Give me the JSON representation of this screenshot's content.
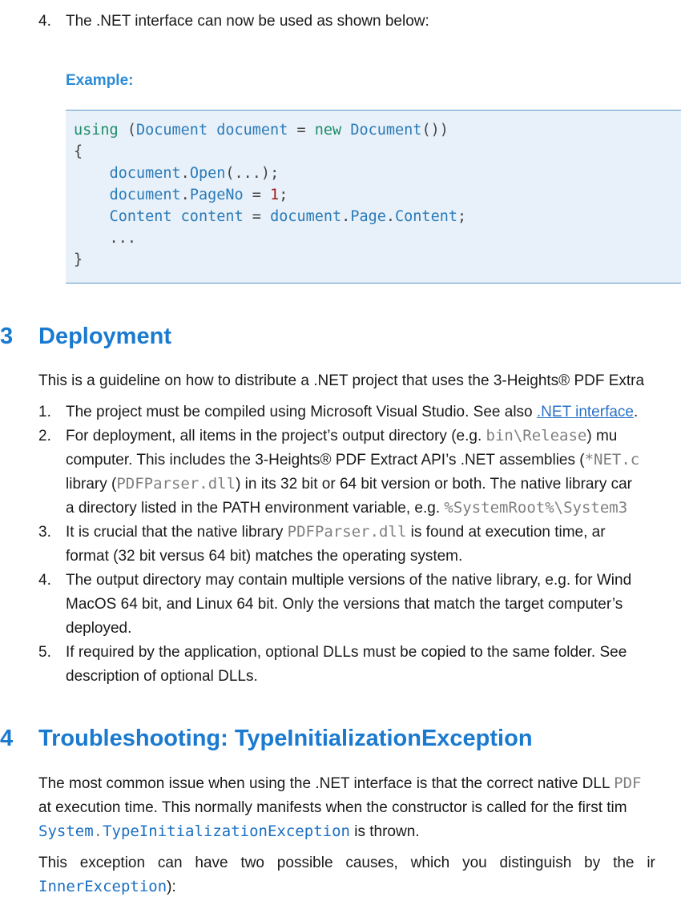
{
  "intro_item": {
    "number": "4.",
    "text": "The .NET interface can now be used as shown below:"
  },
  "example": {
    "label": "Example:",
    "code": {
      "line1": {
        "kw_using": "using",
        "open": " (",
        "type1": "Document",
        "var": " document ",
        "eq": "=",
        "kw_new": " new ",
        "type2": "Document",
        "close": "())"
      },
      "line2": "{",
      "line3": {
        "indent": "    ",
        "obj": "document",
        "dot": ".",
        "member": "Open",
        "rest": "(...);"
      },
      "line4": {
        "indent": "    ",
        "obj": "document",
        "dot": ".",
        "member": "PageNo",
        "eq": " = ",
        "num": "1",
        "semi": ";"
      },
      "line5": {
        "indent": "    ",
        "type": "Content",
        "var": " content ",
        "eq": "=",
        "sp": " ",
        "obj": "document",
        "dot1": ".",
        "m1": "Page",
        "dot2": ".",
        "m2": "Content",
        "semi": ";"
      },
      "line6": "    ...",
      "line7": "}"
    }
  },
  "section_deployment": {
    "number": ".3",
    "title": "Deployment",
    "intro": "This is a guideline on how to distribute a .NET project that uses the 3-Heights® PDF Extra",
    "items": [
      {
        "number": "1.",
        "lines": [
          {
            "pre": "The project must be compiled using Microsoft Visual Studio. See also ",
            "link": ".NET interface",
            "post": "."
          }
        ]
      },
      {
        "number": "2.",
        "lines": [
          {
            "pre": "For deployment, all items in the project’s output directory (e.g. ",
            "code": "bin\\Release",
            "post": ") mu"
          },
          {
            "pre": "computer.  This includes the 3-Heights® PDF Extract API’s .NET assemblies (",
            "code": "*NET.c",
            "post": ""
          },
          {
            "pre": "library (",
            "code": "PDFParser.dll",
            "post": ") in its 32 bit or 64 bit version or both. The native library car"
          },
          {
            "pre": "a directory listed in the PATH environment variable, e.g. ",
            "code": "%SystemRoot%\\System3",
            "post": ""
          }
        ]
      },
      {
        "number": "3.",
        "lines": [
          {
            "pre": "It is crucial that the native library ",
            "code": "PDFParser.dll",
            "post": " is found at execution time, ar"
          },
          {
            "pre": "format (32 bit versus 64 bit) matches the operating system.",
            "code": "",
            "post": ""
          }
        ]
      },
      {
        "number": "4.",
        "lines": [
          {
            "pre": "The output directory may contain multiple versions of the native library, e.g. for Wind",
            "code": "",
            "post": ""
          },
          {
            "pre": "MacOS 64 bit, and Linux 64 bit.  Only the versions that match the target computer’s",
            "code": "",
            "post": ""
          },
          {
            "pre": "deployed.",
            "code": "",
            "post": ""
          }
        ]
      },
      {
        "number": "5.",
        "lines": [
          {
            "pre": "If required by the application, optional DLLs must be copied to the same folder.  See",
            "code": "",
            "post": ""
          },
          {
            "pre": "description of optional DLLs.",
            "code": "",
            "post": ""
          }
        ]
      }
    ]
  },
  "section_troubleshooting": {
    "number": ".4",
    "title": "Troubleshooting: TypeInitializationException",
    "para1": {
      "line1_pre": "The most common issue when using the .NET interface is that the correct native DLL ",
      "line1_code": "PDF",
      "line2": "at execution time. This normally manifests when the constructor is called for the first tim",
      "line3_code_ns": "System",
      "line3_code_dot": ".",
      "line3_code_type": "TypeInitializationException",
      "line3_post": " is thrown."
    },
    "para2": {
      "line1": "This   exception   can   have   two   possible   causes,   which   you   distinguish   by   the   ir",
      "line2_code": "InnerException",
      "line2_post": "):"
    }
  }
}
